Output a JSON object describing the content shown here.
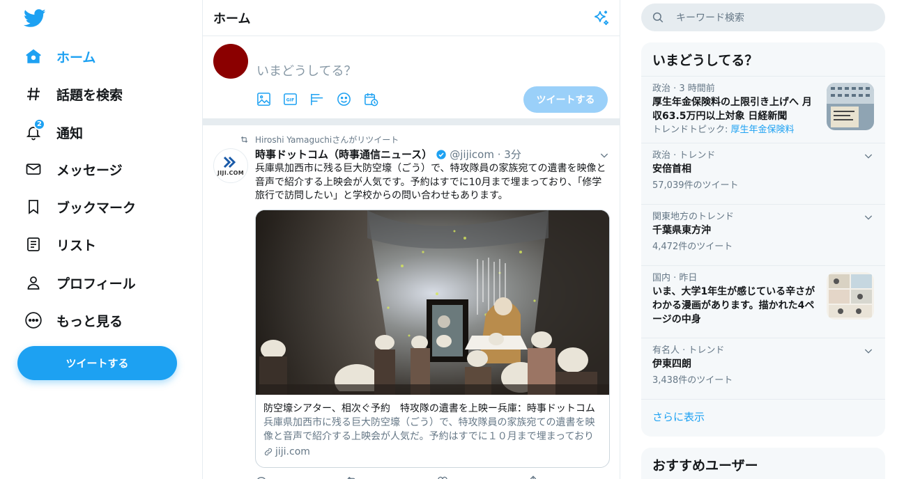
{
  "nav": {
    "items": [
      {
        "label": "ホーム",
        "icon": "home-icon",
        "active": true
      },
      {
        "label": "話題を検索",
        "icon": "hashtag-icon"
      },
      {
        "label": "通知",
        "icon": "bell-icon",
        "badge": "2"
      },
      {
        "label": "メッセージ",
        "icon": "envelope-icon"
      },
      {
        "label": "ブックマーク",
        "icon": "bookmark-icon"
      },
      {
        "label": "リスト",
        "icon": "list-icon"
      },
      {
        "label": "プロフィール",
        "icon": "person-icon"
      },
      {
        "label": "もっと見る",
        "icon": "more-circle-icon"
      }
    ],
    "tweet_button": "ツイートする"
  },
  "center": {
    "title": "ホーム",
    "composer": {
      "placeholder": "いまどうしてる？",
      "button": "ツイートする"
    },
    "tweet": {
      "retweeted_by": "Hiroshi Yamaguchiさんがリツイート",
      "avatar_text": "JIJI.COM",
      "name": "時事ドットコム（時事通信ニュース）",
      "handle_time": "@jijicom · 3分",
      "body": "兵庫県加西市に残る巨大防空壕（ごう）で、特攻隊員の家族宛ての遺書を映像と音声で紹介する上映会が人気です。予約はすでに10月まで埋まっており、「修学旅行で訪問したい」と学校からの問い合わせもあります。",
      "card": {
        "title": "防空壕シアター、相次ぐ予約　特攻隊の遺書を上映ー兵庫：時事ドットコム",
        "description": "兵庫県加西市に残る巨大防空壕（ごう）で、特攻隊員の家族宛ての遺書を映像と音声で紹介する上映会が人気だ。予約はすでに１０月まで埋まっており",
        "domain": "jiji.com"
      }
    }
  },
  "right": {
    "search_placeholder": "キーワード検索",
    "trends_title": "いまどうしてる？",
    "trends": [
      {
        "context": "政治 · 3 時間前",
        "name": "厚生年金保険料の上限引き上げへ 月収63.5万円以上対象 日経新聞",
        "topic_prefix": "トレンドトピック: ",
        "topic": "厚生年金保険料"
      },
      {
        "context": "政治 · トレンド",
        "name": "安倍首相",
        "count": "57,039件のツイート"
      },
      {
        "context": "関東地方のトレンド",
        "name": "千葉県東方沖",
        "count": "4,472件のツイート"
      },
      {
        "context": "国内 · 昨日",
        "name": "いま、大学1年生が感じている辛さがわかる漫画があります。描かれた4ページの中身"
      },
      {
        "context": "有名人 · トレンド",
        "name": "伊東四朗",
        "count": "3,438件のツイート"
      }
    ],
    "show_more": "さらに表示",
    "recommend_title": "おすすめユーザー"
  },
  "colors": {
    "accent": "#1da1f2",
    "accent_disabled": "#9ad0f9",
    "panel_bg": "#f5f8fa",
    "border": "#e6ecf0"
  }
}
